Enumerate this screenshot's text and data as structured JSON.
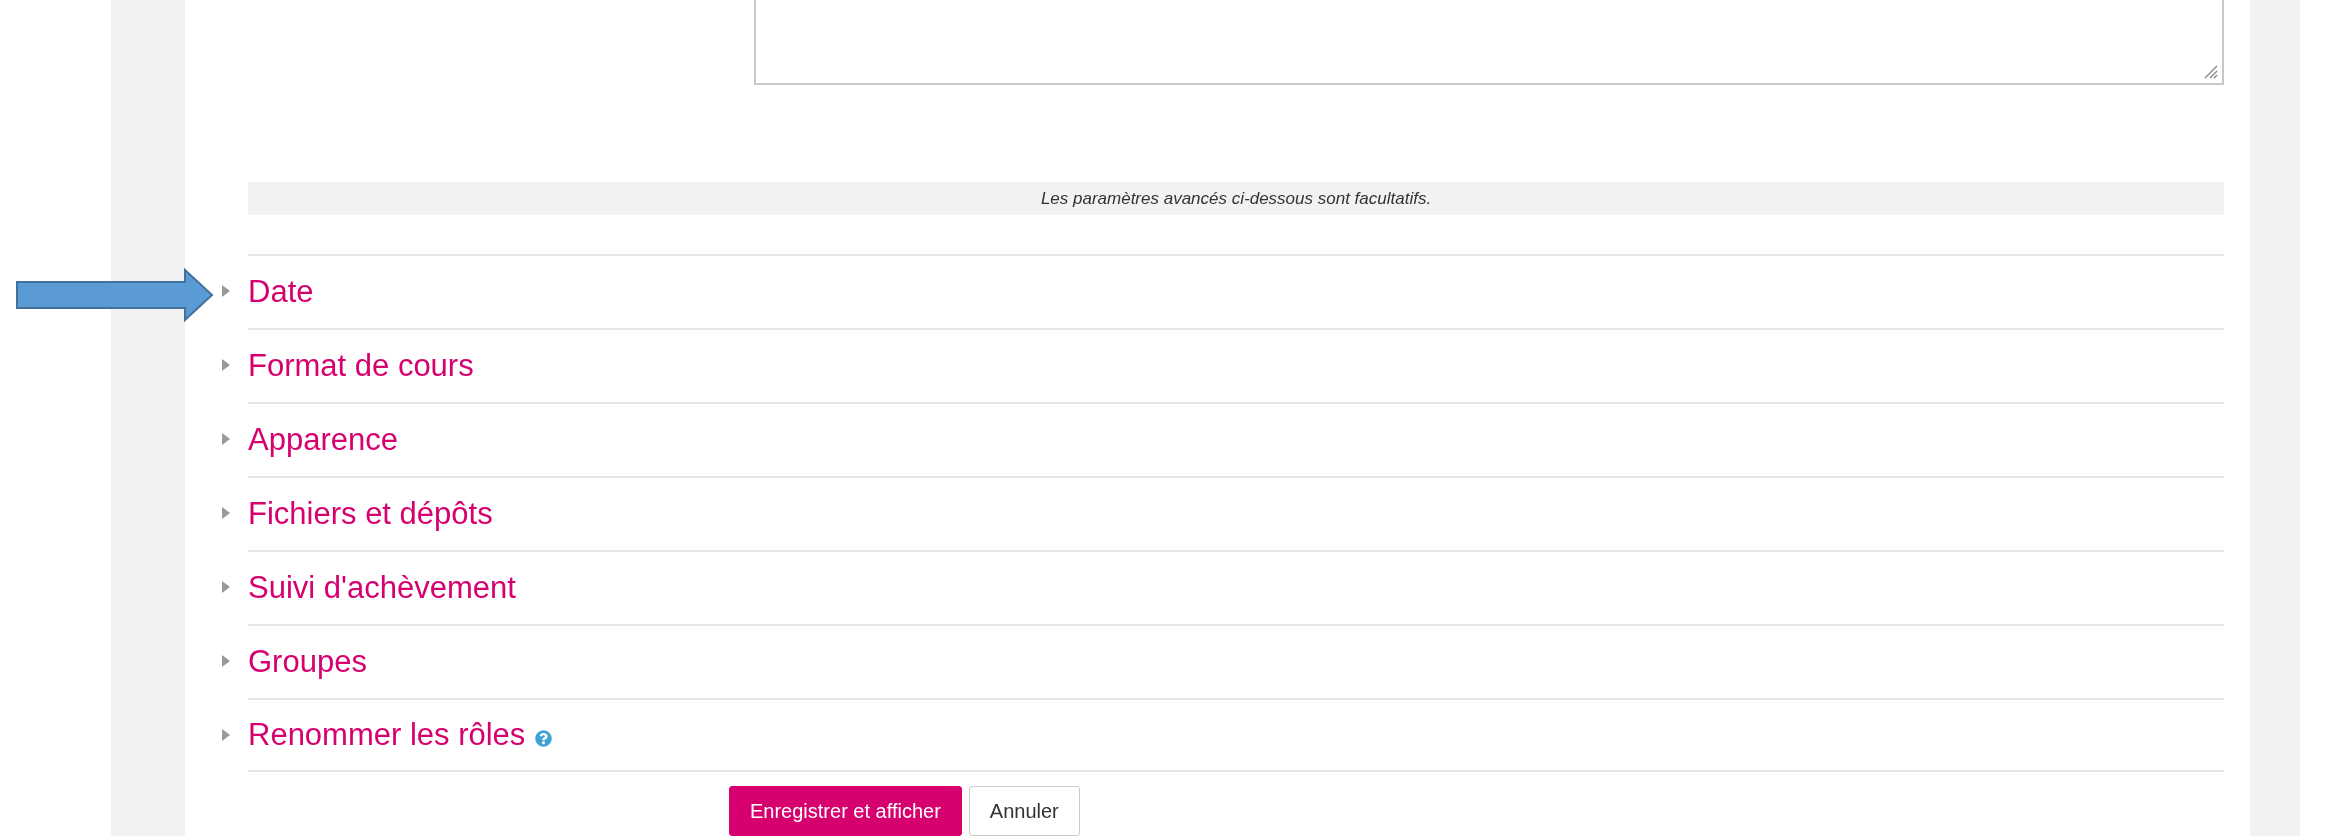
{
  "notice": "Les paramètres avancés ci-dessous sont facultatifs.",
  "sections": [
    {
      "label": "Date",
      "expanded": false,
      "help": false
    },
    {
      "label": "Format de cours",
      "expanded": false,
      "help": false
    },
    {
      "label": "Apparence",
      "expanded": false,
      "help": false
    },
    {
      "label": "Fichiers et dépôts",
      "expanded": false,
      "help": false
    },
    {
      "label": "Suivi d'achèvement",
      "expanded": false,
      "help": false
    },
    {
      "label": "Groupes",
      "expanded": false,
      "help": false
    },
    {
      "label": "Renommer les rôles",
      "expanded": false,
      "help": true
    }
  ],
  "buttons": [
    {
      "label": "Enregistrer et afficher",
      "kind": "primary"
    },
    {
      "label": "Annuler",
      "kind": "secondary"
    }
  ]
}
